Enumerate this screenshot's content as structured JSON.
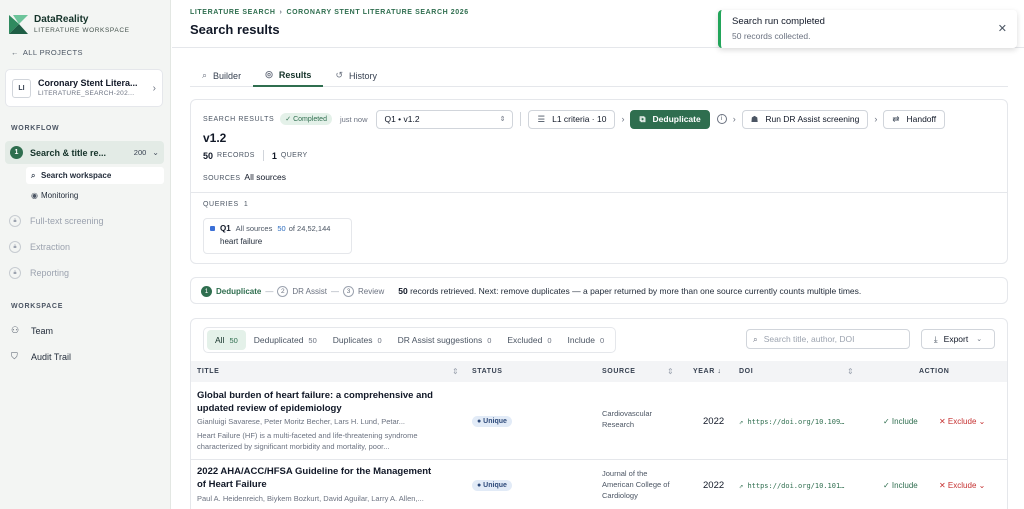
{
  "app": {
    "name": "DataReality",
    "subtitle": "LITERATURE WORKSPACE",
    "all_projects": "ALL PROJECTS"
  },
  "project": {
    "initials": "LI",
    "name": "Coronary Stent Litera...",
    "id": "LITERATURE_SEARCH-202..."
  },
  "sidebar": {
    "workflow_label": "WORKFLOW",
    "active_step": {
      "num": "1",
      "label": "Search & title re...",
      "count": "200"
    },
    "subitems": [
      {
        "label": "Search workspace",
        "icon": "search-icon"
      },
      {
        "label": "Monitoring",
        "icon": "monitoring-icon"
      }
    ],
    "locked": [
      {
        "label": "Full-text screening"
      },
      {
        "label": "Extraction"
      },
      {
        "label": "Reporting"
      }
    ],
    "workspace_label": "WORKSPACE",
    "workspace_items": [
      {
        "label": "Team",
        "icon": "team-icon"
      },
      {
        "label": "Audit Trail",
        "icon": "shield-icon"
      }
    ]
  },
  "header": {
    "crumb1": "LITERATURE SEARCH",
    "crumb2": "CORONARY STENT LITERATURE SEARCH 2026",
    "title": "Search results"
  },
  "tabs": [
    {
      "label": "Builder"
    },
    {
      "label": "Results"
    },
    {
      "label": "History"
    }
  ],
  "summary": {
    "label": "SEARCH RESULTS",
    "status": "✓ Completed",
    "time": "just now",
    "selector": "Q1 • v1.2",
    "criteria": "L1 criteria · 10",
    "dedup": "Deduplicate",
    "screening": "Run DR Assist screening",
    "handoff": "Handoff",
    "version": "v1.2",
    "records_n": "50",
    "records_lbl": "RECORDS",
    "query_n": "1",
    "query_lbl": "QUERY",
    "sources_lbl": "SOURCES",
    "sources_val": "All sources",
    "queries_lbl": "QUERIES",
    "queries_n": "1",
    "query": {
      "id": "Q1",
      "source": "All sources",
      "count": "50",
      "of": "of 24,52,144",
      "name": "heart failure"
    }
  },
  "steps": {
    "s1": {
      "n": "1",
      "label": "Deduplicate"
    },
    "s2": {
      "n": "2",
      "label": "DR Assist"
    },
    "s3": {
      "n": "3",
      "label": "Review"
    },
    "msg_bold": "50",
    "msg": "records retrieved. Next: remove duplicates — a paper returned by more than one source currently counts multiple times."
  },
  "filters": [
    {
      "label": "All",
      "n": "50"
    },
    {
      "label": "Deduplicated",
      "n": "50"
    },
    {
      "label": "Duplicates",
      "n": "0"
    },
    {
      "label": "DR Assist suggestions",
      "n": "0"
    },
    {
      "label": "Excluded",
      "n": "0"
    },
    {
      "label": "Include",
      "n": "0"
    }
  ],
  "search_placeholder": "Search title, author, DOI",
  "export_label": "Export",
  "columns": {
    "title": "TITLE",
    "status": "STATUS",
    "source": "SOURCE",
    "year": "YEAR ↓",
    "doi": "DOI",
    "action": "ACTION"
  },
  "rows": [
    {
      "title": "Global burden of heart failure: a comprehensive and updated review of epidemiology",
      "authors": "Gianluigi Savarese, Peter Moritz Becher, Lars H. Lund, Petar...",
      "abstract": "Heart Failure (HF) is a multi-faceted and life-threatening syndrome characterized by significant morbidity and mortality, poor...",
      "status": "● Unique",
      "source": "Cardiovascular Research",
      "year": "2022",
      "doi": "https://doi.org/10.109…",
      "include": "✓ Include",
      "exclude": "✕ Exclude ⌄"
    },
    {
      "title": "2022 AHA/ACC/HFSA Guideline for the Management of Heart Failure",
      "authors": "Paul A. Heidenreich, Biykem Bozkurt, David Aguilar, Larry A. Allen,...",
      "abstract": "",
      "status": "● Unique",
      "source": "Journal of the American College of Cardiology",
      "year": "2022",
      "doi": "https://doi.org/10.101…",
      "include": "✓ Include",
      "exclude": "✕ Exclude ⌄"
    }
  ],
  "toast": {
    "title": "Search run completed",
    "message": "50 records collected."
  },
  "colors": {
    "accent": "#2f6e4f",
    "toast_bar": "#22a55a",
    "exclude": "#c53030"
  }
}
